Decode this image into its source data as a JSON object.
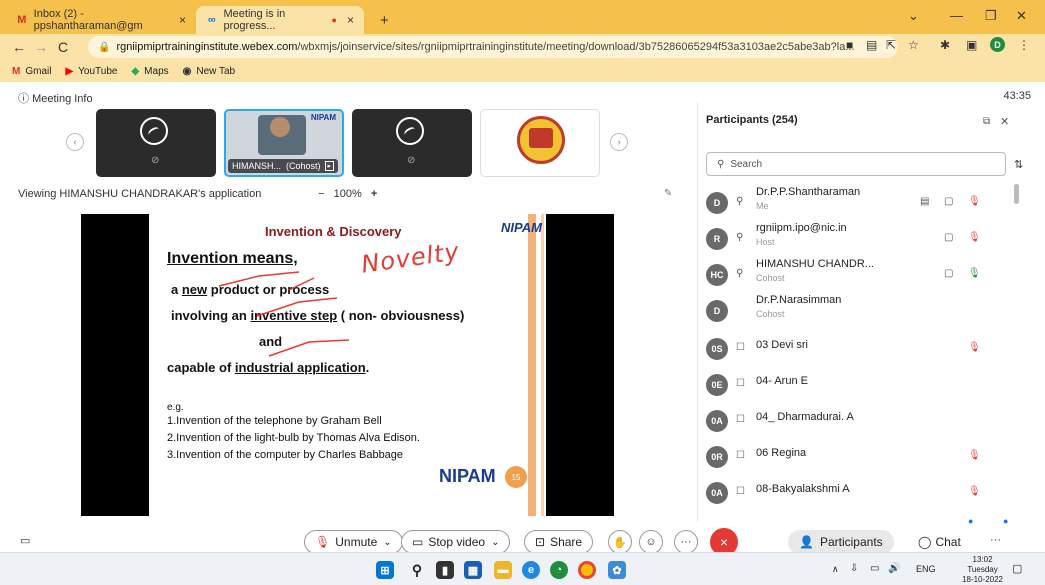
{
  "browser": {
    "tabs": [
      {
        "icon": "M",
        "label": "Inbox (2) - ppshantharaman@gm",
        "close": "×"
      },
      {
        "icon": "∞",
        "label": "Meeting is in progress...",
        "close": "×",
        "recording_dot": "●"
      }
    ],
    "new_tab": "+",
    "url_host": "rgniipmiprtraininginstitute.webex.com",
    "url_path": "/wbxmjs/joinservice/sites/rgniipmiprtraininginstitute/meeting/download/3b75286065294f53a3103ae2c5abe3ab?la...",
    "profile_initial": "D",
    "bookmarks": [
      {
        "icon": "M",
        "label": "Gmail",
        "color": "#d93025"
      },
      {
        "icon": "▶",
        "label": "YouTube",
        "color": "#ff0000"
      },
      {
        "icon": "◆",
        "label": "Maps",
        "color": "#34a853"
      },
      {
        "icon": "◉",
        "label": "New Tab",
        "color": "#333333"
      }
    ]
  },
  "meeting": {
    "info_label": "Meeting Info",
    "timer": "43:35",
    "featured_name": "HIMANSH...",
    "featured_role": "(Cohost)",
    "viewing_text": "Viewing HIMANSHU CHANDRAKAR's application",
    "zoom_minus": "−",
    "zoom_level": "100%",
    "zoom_plus": "+"
  },
  "slide": {
    "title": "Invention  & Discovery",
    "logo": "NIPAM",
    "heading": "Invention means,",
    "line1_prefix": "a ",
    "line1_underlined": "new",
    "line1_rest": " product or process",
    "handwriting": "Novelty",
    "line2_prefix": "involving an ",
    "line2_underlined": "inventive step",
    "line2_rest": " ( non- obviousness)",
    "line3": "and",
    "line4_prefix": "capable of ",
    "line4_underlined": "industrial application",
    "line4_rest": ".",
    "eg": "e.g.",
    "examples": [
      "1.Invention of the telephone by Graham Bell",
      "2.Invention of the light-bulb by Thomas Alva Edison.",
      "3.Invention of the computer by Charles Babbage"
    ],
    "footer_logo": "NIPAM",
    "page_number": "15"
  },
  "participants": {
    "title": "Participants (254)",
    "search_placeholder": "Search",
    "list": [
      {
        "initials": "D",
        "name": "Dr.P.P.Shantharaman",
        "role": "Me",
        "color": "#5f6368"
      },
      {
        "initials": "R",
        "name": "rgniipm.ipo@nic.in",
        "role": "Host",
        "color": "#5f6368"
      },
      {
        "initials": "HC",
        "name": "HIMANSHU CHANDR...",
        "role": "Cohost",
        "color": "#5f6368"
      },
      {
        "initials": "D",
        "name": "Dr.P.Narasimman",
        "role": "Cohost",
        "color": "#5f6368"
      },
      {
        "initials": "0S",
        "name": "03 Devi sri",
        "role": "",
        "color": "#5f6368"
      },
      {
        "initials": "0E",
        "name": "04- Arun E",
        "role": "",
        "color": "#5f6368"
      },
      {
        "initials": "0A",
        "name": "04_ Dharmadurai. A",
        "role": "",
        "color": "#5f6368"
      },
      {
        "initials": "0R",
        "name": "06 Regina",
        "role": "",
        "color": "#5f6368"
      },
      {
        "initials": "0A",
        "name": "08-Bakyalakshmi A",
        "role": "",
        "color": "#5f6368"
      }
    ]
  },
  "controls": {
    "unmute": "Unmute",
    "stop_video": "Stop video",
    "share": "Share",
    "more": "···",
    "end": "×",
    "participants": "Participants",
    "chat": "Chat",
    "overflow": "···"
  },
  "taskbar": {
    "time": "13:02",
    "day": "Tuesday",
    "date": "18-10-2022",
    "lang": "ENG"
  },
  "colors": {
    "tab_strip": "#f5c04c",
    "toolbar": "#fbe3a8",
    "end_button": "#e53935",
    "slide_title": "#8b1a1a",
    "handwriting": "#e53935"
  }
}
